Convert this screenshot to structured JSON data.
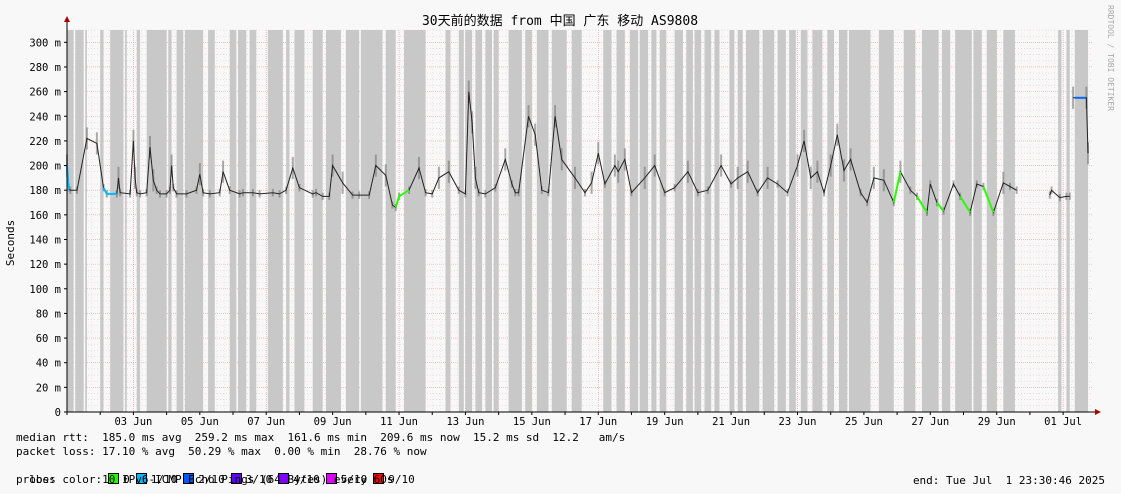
{
  "watermark": "RRDTOOL / TOBI OETIKER",
  "chart_data": {
    "type": "line",
    "title": "30天前的数据 from 中国 广东 移动 AS9808",
    "ylabel": "Seconds",
    "ylim": [
      0,
      310
    ],
    "y_ticks": [
      {
        "value": 0,
        "label": "0"
      },
      {
        "value": 20,
        "label": "20 m"
      },
      {
        "value": 40,
        "label": "40 m"
      },
      {
        "value": 60,
        "label": "60 m"
      },
      {
        "value": 80,
        "label": "80 m"
      },
      {
        "value": 100,
        "label": "100 m"
      },
      {
        "value": 120,
        "label": "120 m"
      },
      {
        "value": 140,
        "label": "140 m"
      },
      {
        "value": 160,
        "label": "160 m"
      },
      {
        "value": 180,
        "label": "180 m"
      },
      {
        "value": 200,
        "label": "200 m"
      },
      {
        "value": 220,
        "label": "220 m"
      },
      {
        "value": 240,
        "label": "240 m"
      },
      {
        "value": 260,
        "label": "260 m"
      },
      {
        "value": 280,
        "label": "280 m"
      },
      {
        "value": 300,
        "label": "300 m"
      }
    ],
    "x_range_days": [
      0,
      30.9
    ],
    "x_ticks": [
      {
        "day": 2,
        "label": "03 Jun"
      },
      {
        "day": 4,
        "label": "05 Jun"
      },
      {
        "day": 6,
        "label": "07 Jun"
      },
      {
        "day": 8,
        "label": "09 Jun"
      },
      {
        "day": 10,
        "label": "11 Jun"
      },
      {
        "day": 12,
        "label": "13 Jun"
      },
      {
        "day": 14,
        "label": "15 Jun"
      },
      {
        "day": 16,
        "label": "17 Jun"
      },
      {
        "day": 18,
        "label": "19 Jun"
      },
      {
        "day": 20,
        "label": "21 Jun"
      },
      {
        "day": 22,
        "label": "23 Jun"
      },
      {
        "day": 24,
        "label": "25 Jun"
      },
      {
        "day": 26,
        "label": "27 Jun"
      },
      {
        "day": 28,
        "label": "29 Jun"
      },
      {
        "day": 30,
        "label": "01 Jul"
      }
    ],
    "median_rtt_series": {
      "x_days": [
        0.0,
        0.05,
        0.1,
        0.3,
        0.6,
        0.9,
        1.1,
        1.2,
        1.5,
        1.55,
        1.6,
        1.9,
        2.0,
        2.05,
        2.1,
        2.2,
        2.4,
        2.5,
        2.6,
        2.7,
        2.8,
        3.0,
        3.1,
        3.15,
        3.2,
        3.3,
        3.6,
        3.9,
        4.0,
        4.1,
        4.3,
        4.6,
        4.7,
        4.9,
        5.2,
        5.3,
        5.6,
        5.8,
        6.2,
        6.4,
        6.6,
        6.8,
        7.0,
        7.4,
        7.5,
        7.7,
        7.9,
        8.0,
        8.3,
        8.6,
        8.8,
        9.1,
        9.3,
        9.6,
        9.8,
        9.9,
        10.0,
        10.3,
        10.6,
        10.8,
        11.0,
        11.2,
        11.5,
        11.8,
        12.0,
        12.1,
        12.2,
        12.3,
        12.4,
        12.6,
        12.9,
        13.2,
        13.4,
        13.5,
        13.6,
        13.9,
        14.1,
        14.3,
        14.5,
        14.7,
        14.9,
        15.3,
        15.6,
        15.8,
        16.0,
        16.2,
        16.5,
        16.6,
        16.8,
        17.0,
        17.4,
        17.7,
        18.0,
        18.3,
        18.7,
        19.0,
        19.3,
        19.7,
        20.0,
        20.2,
        20.5,
        20.8,
        21.1,
        21.4,
        21.7,
        22.0,
        22.2,
        22.4,
        22.6,
        22.8,
        23.0,
        23.2,
        23.4,
        23.6,
        23.9,
        24.1,
        24.3,
        24.6,
        24.9,
        25.1,
        25.4,
        25.6,
        25.9,
        26.0,
        26.2,
        26.4,
        26.7,
        26.9,
        27.2,
        27.4,
        27.6,
        27.9,
        28.2,
        28.4,
        28.6,
        29.0,
        29.6,
        29.65,
        29.9,
        30.1,
        30.2,
        30.3,
        30.7,
        30.75,
        30.9
      ],
      "ms": [
        200,
        182,
        180,
        180,
        222,
        218,
        182,
        177,
        177,
        190,
        178,
        177,
        220,
        190,
        178,
        177,
        178,
        215,
        188,
        180,
        177,
        177,
        180,
        200,
        182,
        177,
        177,
        180,
        193,
        178,
        177,
        178,
        195,
        180,
        177,
        178,
        178,
        177,
        178,
        177,
        180,
        198,
        182,
        177,
        178,
        175,
        175,
        200,
        186,
        176,
        176,
        176,
        200,
        192,
        168,
        166,
        175,
        180,
        198,
        178,
        177,
        190,
        195,
        180,
        177,
        260,
        235,
        190,
        178,
        177,
        182,
        205,
        185,
        178,
        178,
        240,
        225,
        180,
        178,
        240,
        205,
        190,
        178,
        186,
        210,
        185,
        200,
        195,
        205,
        178,
        190,
        200,
        178,
        182,
        195,
        178,
        180,
        200,
        185,
        190,
        195,
        178,
        190,
        185,
        178,
        200,
        220,
        190,
        195,
        178,
        200,
        225,
        196,
        205,
        178,
        170,
        190,
        188,
        170,
        195,
        180,
        175,
        162,
        185,
        170,
        163,
        185,
        175,
        162,
        185,
        183,
        162,
        186,
        183,
        180,
        180,
        176,
        180,
        174,
        175,
        175,
        255,
        255,
        210
      ]
    },
    "outage_gap_days": [
      [
        28.7,
        29.6
      ],
      [
        30.2,
        30.25
      ]
    ],
    "loss_bands_days": [
      [
        0.0,
        0.2
      ],
      [
        0.25,
        0.5
      ],
      [
        0.55,
        0.6
      ],
      [
        1.0,
        1.1
      ],
      [
        1.3,
        1.7
      ],
      [
        1.75,
        1.8
      ],
      [
        2.1,
        2.2
      ],
      [
        2.4,
        3.0
      ],
      [
        3.05,
        3.15
      ],
      [
        3.3,
        3.5
      ],
      [
        3.55,
        4.1
      ],
      [
        4.25,
        4.45
      ],
      [
        4.9,
        5.1
      ],
      [
        5.15,
        5.4
      ],
      [
        5.5,
        5.7
      ],
      [
        6.05,
        6.5
      ],
      [
        6.6,
        6.7
      ],
      [
        6.85,
        7.15
      ],
      [
        7.4,
        7.7
      ],
      [
        7.8,
        8.25
      ],
      [
        8.4,
        8.8
      ],
      [
        8.85,
        9.5
      ],
      [
        9.6,
        9.9
      ],
      [
        10.15,
        10.8
      ],
      [
        11.4,
        11.55
      ],
      [
        11.8,
        11.95
      ],
      [
        12.0,
        12.2
      ],
      [
        12.3,
        12.5
      ],
      [
        12.6,
        12.8
      ],
      [
        12.85,
        13.0
      ],
      [
        13.3,
        13.7
      ],
      [
        13.8,
        14.0
      ],
      [
        14.15,
        14.5
      ],
      [
        14.6,
        15.05
      ],
      [
        15.2,
        15.5
      ],
      [
        16.15,
        16.4
      ],
      [
        16.55,
        16.8
      ],
      [
        16.95,
        17.2
      ],
      [
        17.25,
        17.5
      ],
      [
        17.6,
        17.75
      ],
      [
        17.85,
        18.05
      ],
      [
        18.3,
        18.55
      ],
      [
        18.65,
        18.85
      ],
      [
        18.9,
        19.1
      ],
      [
        19.2,
        19.4
      ],
      [
        19.5,
        19.65
      ],
      [
        19.95,
        20.1
      ],
      [
        20.2,
        20.35
      ],
      [
        20.45,
        20.85
      ],
      [
        20.95,
        21.3
      ],
      [
        21.4,
        21.65
      ],
      [
        21.75,
        21.95
      ],
      [
        22.1,
        22.3
      ],
      [
        22.45,
        22.75
      ],
      [
        22.9,
        23.1
      ],
      [
        23.25,
        23.5
      ],
      [
        23.55,
        24.2
      ],
      [
        24.45,
        24.9
      ],
      [
        25.2,
        25.55
      ],
      [
        25.75,
        26.25
      ],
      [
        26.35,
        26.6
      ],
      [
        26.75,
        27.25
      ],
      [
        27.3,
        27.55
      ],
      [
        27.7,
        28.0
      ],
      [
        28.2,
        28.55
      ],
      [
        29.85,
        29.95
      ],
      [
        30.1,
        30.2
      ],
      [
        30.35,
        30.75
      ]
    ],
    "loss_color_segments": [
      {
        "from_day": 0.0,
        "to_day": 0.08,
        "color": "#00b8ff"
      },
      {
        "from_day": 1.1,
        "to_day": 1.5,
        "color": "#00b8ff"
      },
      {
        "from_day": 9.9,
        "to_day": 10.3,
        "color": "#26ff00"
      },
      {
        "from_day": 24.9,
        "to_day": 25.1,
        "color": "#26ff00"
      },
      {
        "from_day": 25.6,
        "to_day": 25.9,
        "color": "#26ff00"
      },
      {
        "from_day": 26.2,
        "to_day": 26.4,
        "color": "#26ff00"
      },
      {
        "from_day": 26.9,
        "to_day": 27.2,
        "color": "#26ff00"
      },
      {
        "from_day": 27.6,
        "to_day": 27.9,
        "color": "#26ff00"
      },
      {
        "from_day": 30.35,
        "to_day": 30.7,
        "color": "#0066ff"
      }
    ],
    "grid": true
  },
  "stats": {
    "median_rtt": "median rtt:  185.0 ms avg  259.2 ms max  161.6 ms min  209.6 ms now  15.2 ms sd  12.2   am/s",
    "packet_loss": "packet loss: 17.10 % avg  50.29 % max  0.00 % min  28.76 % now",
    "loss_color_label": "loss color:",
    "loss_legend": [
      {
        "label": "0",
        "color": "#26ff00"
      },
      {
        "label": "1/10",
        "color": "#00b8ff"
      },
      {
        "label": "2/10",
        "color": "#0059ff"
      },
      {
        "label": "3/10",
        "color": "#5e00ff"
      },
      {
        "label": "4/10",
        "color": "#7e00ff"
      },
      {
        "label": "5/10",
        "color": "#dd00ff"
      },
      {
        "label": "9/10",
        "color": "#ff0000"
      }
    ],
    "probe": "probe:       10 IPv6-ICMP Echo Pings (64 Bytes) every 60s",
    "end": "end: Tue Jul  1 23:30:46 2025"
  }
}
